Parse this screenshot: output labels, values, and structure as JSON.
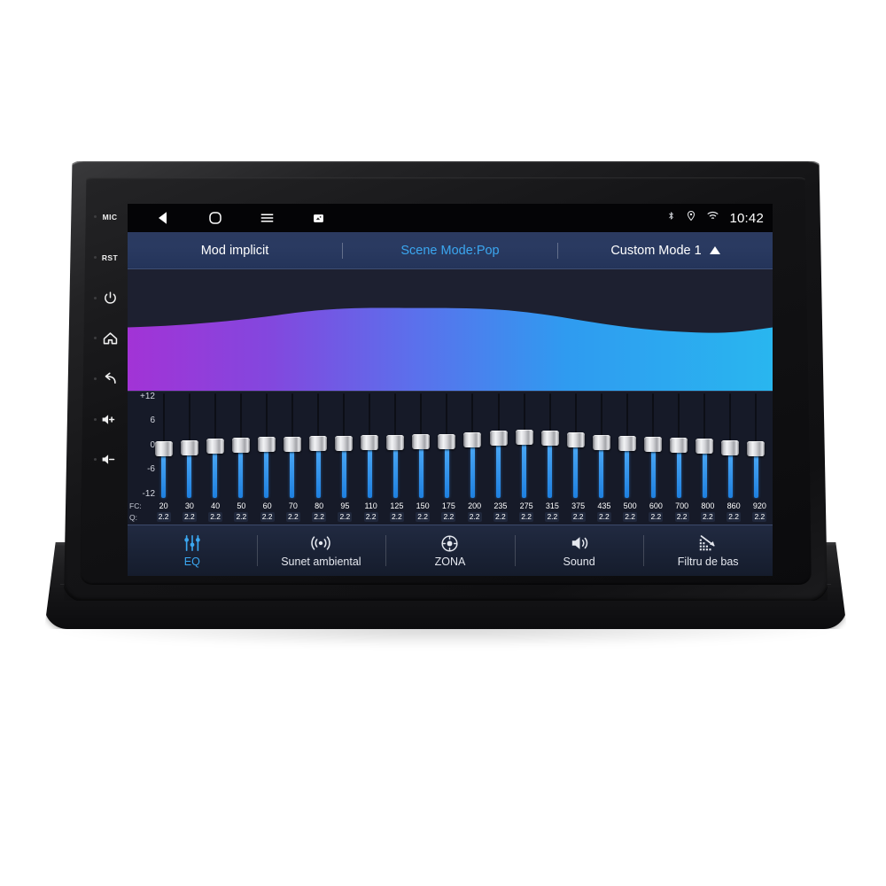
{
  "device": {
    "hard_keys": [
      {
        "name": "mic-key",
        "label": "MIC",
        "icon": "text"
      },
      {
        "name": "reset-key",
        "label": "RST",
        "icon": "text"
      },
      {
        "name": "power-key",
        "label": "",
        "icon": "power-icon"
      },
      {
        "name": "home-key",
        "label": "",
        "icon": "home-icon"
      },
      {
        "name": "back-key",
        "label": "",
        "icon": "back-arrow-icon"
      },
      {
        "name": "volume-up-key",
        "label": "",
        "icon": "volume-up-icon"
      },
      {
        "name": "volume-down-key",
        "label": "",
        "icon": "volume-down-icon"
      }
    ]
  },
  "statusbar": {
    "nav_buttons": [
      "back-icon",
      "home-icon",
      "menu-icon",
      "screenshot-icon"
    ],
    "indicators": [
      "bluetooth-icon",
      "location-icon",
      "wifi-icon"
    ],
    "clock": "10:42"
  },
  "modebar": {
    "default_mode": "Mod implicit",
    "scene_mode": "Scene Mode:Pop",
    "custom_mode": "Custom Mode 1",
    "expand_icon": "triangle-up-icon",
    "accent_color": "#3ba7f0"
  },
  "spectrum": {
    "gradient_start": "#a233d6",
    "gradient_end": "#29b6ef",
    "background": "#1d2030"
  },
  "equalizer": {
    "db_scale": [
      "+12",
      "6",
      "0",
      "-6",
      "-12"
    ],
    "fc_label": "FC:",
    "q_label": "Q:",
    "bands": [
      {
        "fc": "20",
        "q": "2.2",
        "gain": 0
      },
      {
        "fc": "30",
        "q": "2.2",
        "gain": 0
      },
      {
        "fc": "40",
        "q": "2.2",
        "gain": 0
      },
      {
        "fc": "50",
        "q": "2.2",
        "gain": 0
      },
      {
        "fc": "60",
        "q": "2.2",
        "gain": 0
      },
      {
        "fc": "70",
        "q": "2.2",
        "gain": 0
      },
      {
        "fc": "80",
        "q": "2.2",
        "gain": 0
      },
      {
        "fc": "95",
        "q": "2.2",
        "gain": 0
      },
      {
        "fc": "110",
        "q": "2.2",
        "gain": 0
      },
      {
        "fc": "125",
        "q": "2.2",
        "gain": 0
      },
      {
        "fc": "150",
        "q": "2.2",
        "gain": 0
      },
      {
        "fc": "175",
        "q": "2.2",
        "gain": 0
      },
      {
        "fc": "200",
        "q": "2.2",
        "gain": 0
      },
      {
        "fc": "235",
        "q": "2.2",
        "gain": 0
      },
      {
        "fc": "275",
        "q": "2.2",
        "gain": 0
      },
      {
        "fc": "315",
        "q": "2.2",
        "gain": 0
      },
      {
        "fc": "375",
        "q": "2.2",
        "gain": 0
      },
      {
        "fc": "435",
        "q": "2.2",
        "gain": 0
      },
      {
        "fc": "500",
        "q": "2.2",
        "gain": 0
      },
      {
        "fc": "600",
        "q": "2.2",
        "gain": 0
      },
      {
        "fc": "700",
        "q": "2.2",
        "gain": 0
      },
      {
        "fc": "800",
        "q": "2.2",
        "gain": 0
      },
      {
        "fc": "860",
        "q": "2.2",
        "gain": 0
      },
      {
        "fc": "920",
        "q": "2.2",
        "gain": 0
      }
    ]
  },
  "tabs": [
    {
      "name": "tab-eq",
      "label": "EQ",
      "icon": "equalizer-icon",
      "active": true
    },
    {
      "name": "tab-ambient-sound",
      "label": "Sunet ambiental",
      "icon": "ambient-icon",
      "active": false
    },
    {
      "name": "tab-zone",
      "label": "ZONA",
      "icon": "zone-icon",
      "active": false
    },
    {
      "name": "tab-sound",
      "label": "Sound",
      "icon": "speaker-icon",
      "active": false
    },
    {
      "name": "tab-bass-filter",
      "label": "Filtru de bas",
      "icon": "bass-filter-icon",
      "active": false
    }
  ]
}
